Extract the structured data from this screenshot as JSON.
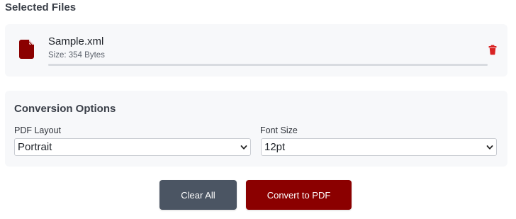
{
  "section_title": "Selected Files",
  "file": {
    "icon": "file-icon",
    "name": "Sample.xml",
    "size_text": "Size: 354 Bytes",
    "progress_fraction": 1.0,
    "delete_icon": "trash-icon"
  },
  "options": {
    "title": "Conversion Options",
    "layout": {
      "label": "PDF Layout",
      "value": "Portrait"
    },
    "font_size": {
      "label": "Font Size",
      "value": "12pt"
    }
  },
  "actions": {
    "clear_label": "Clear All",
    "convert_label": "Convert to PDF"
  },
  "colors": {
    "brand": "#8b0000",
    "clear_button": "#4b5563",
    "delete_icon": "#d92323"
  }
}
